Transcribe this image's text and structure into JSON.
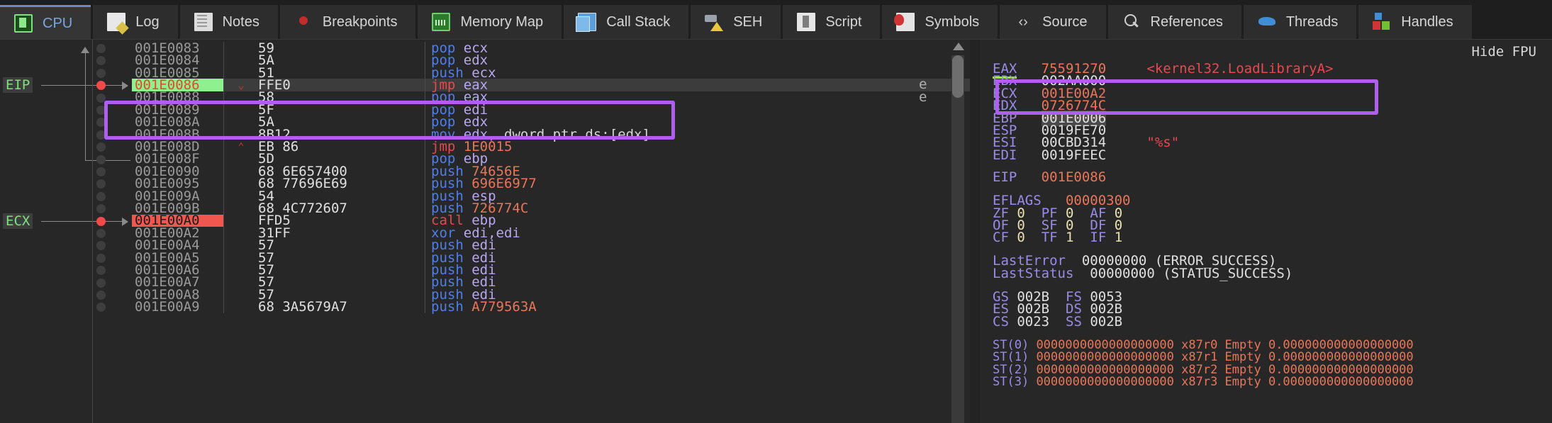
{
  "tabs": [
    {
      "label": "CPU",
      "icon": "cpu-icon",
      "active": true
    },
    {
      "label": "Log",
      "icon": "log-icon",
      "active": false
    },
    {
      "label": "Notes",
      "icon": "notes-icon",
      "active": false
    },
    {
      "label": "Breakpoints",
      "icon": "breakpoint-icon",
      "active": false
    },
    {
      "label": "Memory Map",
      "icon": "memory-map-icon",
      "active": false
    },
    {
      "label": "Call Stack",
      "icon": "call-stack-icon",
      "active": false
    },
    {
      "label": "SEH",
      "icon": "seh-icon",
      "active": false
    },
    {
      "label": "Script",
      "icon": "script-icon",
      "active": false
    },
    {
      "label": "Symbols",
      "icon": "symbols-icon",
      "active": false
    },
    {
      "label": "Source",
      "icon": "source-icon",
      "active": false
    },
    {
      "label": "References",
      "icon": "references-icon",
      "active": false
    },
    {
      "label": "Threads",
      "icon": "threads-icon",
      "active": false
    },
    {
      "label": "Handles",
      "icon": "handles-icon",
      "active": false
    }
  ],
  "side_markers": [
    {
      "label": "EIP",
      "row": 3
    },
    {
      "label": "ECX",
      "row": 14
    }
  ],
  "disassembly": {
    "rows": [
      {
        "addr": "001E0083",
        "bytes": "59",
        "mn": "pop",
        "ops": [
          {
            "t": "reg",
            "v": "ecx"
          }
        ],
        "bp": false,
        "state": "normal",
        "arrow": ""
      },
      {
        "addr": "001E0084",
        "bytes": "5A",
        "mn": "pop",
        "ops": [
          {
            "t": "reg",
            "v": "edx"
          }
        ],
        "bp": false,
        "state": "normal",
        "arrow": ""
      },
      {
        "addr": "001E0085",
        "bytes": "51",
        "mn": "push",
        "ops": [
          {
            "t": "reg",
            "v": "ecx"
          }
        ],
        "bp": false,
        "state": "normal",
        "arrow": ""
      },
      {
        "addr": "001E0086",
        "bytes": "FFE0",
        "mn": "jmp",
        "ops": [
          {
            "t": "reg",
            "v": "eax"
          }
        ],
        "bp": true,
        "state": "eip",
        "arrow": "v"
      },
      {
        "addr": "001E0088",
        "bytes": "58",
        "mn": "pop",
        "ops": [
          {
            "t": "reg",
            "v": "eax"
          }
        ],
        "bp": false,
        "state": "normal",
        "arrow": ""
      },
      {
        "addr": "001E0089",
        "bytes": "5F",
        "mn": "pop",
        "ops": [
          {
            "t": "reg",
            "v": "edi"
          }
        ],
        "bp": false,
        "state": "normal",
        "arrow": ""
      },
      {
        "addr": "001E008A",
        "bytes": "5A",
        "mn": "pop",
        "ops": [
          {
            "t": "reg",
            "v": "edx"
          }
        ],
        "bp": false,
        "state": "normal",
        "arrow": ""
      },
      {
        "addr": "001E008B",
        "bytes": "8B12",
        "mn": "mov",
        "ops": [
          {
            "t": "reg",
            "v": "edx,"
          },
          {
            "t": "mem",
            "v": "dword ptr  ds:[edx]"
          }
        ],
        "bp": false,
        "state": "normal",
        "arrow": ""
      },
      {
        "addr": "001E008D",
        "bytes": "EB 86",
        "mn": "jmp",
        "ops": [
          {
            "t": "imm",
            "v": "1E0015"
          }
        ],
        "bp": false,
        "state": "normal",
        "arrow": "^"
      },
      {
        "addr": "001E008F",
        "bytes": "5D",
        "mn": "pop",
        "ops": [
          {
            "t": "reg",
            "v": "ebp"
          }
        ],
        "bp": false,
        "state": "normal",
        "arrow": ""
      },
      {
        "addr": "001E0090",
        "bytes": "68 6E657400",
        "mn": "push",
        "ops": [
          {
            "t": "imm",
            "v": "74656E"
          }
        ],
        "bp": false,
        "state": "normal",
        "arrow": ""
      },
      {
        "addr": "001E0095",
        "bytes": "68 77696E69",
        "mn": "push",
        "ops": [
          {
            "t": "imm",
            "v": "696E6977"
          }
        ],
        "bp": false,
        "state": "normal",
        "arrow": ""
      },
      {
        "addr": "001E009A",
        "bytes": "54",
        "mn": "push",
        "ops": [
          {
            "t": "reg",
            "v": "esp"
          }
        ],
        "bp": false,
        "state": "normal",
        "arrow": ""
      },
      {
        "addr": "001E009B",
        "bytes": "68 4C772607",
        "mn": "push",
        "ops": [
          {
            "t": "imm",
            "v": "726774C"
          }
        ],
        "bp": false,
        "state": "normal",
        "arrow": ""
      },
      {
        "addr": "001E00A0",
        "bytes": "FFD5",
        "mn": "call",
        "ops": [
          {
            "t": "reg",
            "v": "ebp"
          }
        ],
        "bp": true,
        "state": "bp",
        "arrow": ""
      },
      {
        "addr": "001E00A2",
        "bytes": "31FF",
        "mn": "xor",
        "ops": [
          {
            "t": "reg",
            "v": "edi,edi"
          }
        ],
        "bp": false,
        "state": "normal",
        "arrow": ""
      },
      {
        "addr": "001E00A4",
        "bytes": "57",
        "mn": "push",
        "ops": [
          {
            "t": "reg",
            "v": "edi"
          }
        ],
        "bp": false,
        "state": "normal",
        "arrow": ""
      },
      {
        "addr": "001E00A5",
        "bytes": "57",
        "mn": "push",
        "ops": [
          {
            "t": "reg",
            "v": "edi"
          }
        ],
        "bp": false,
        "state": "normal",
        "arrow": ""
      },
      {
        "addr": "001E00A6",
        "bytes": "57",
        "mn": "push",
        "ops": [
          {
            "t": "reg",
            "v": "edi"
          }
        ],
        "bp": false,
        "state": "normal",
        "arrow": ""
      },
      {
        "addr": "001E00A7",
        "bytes": "57",
        "mn": "push",
        "ops": [
          {
            "t": "reg",
            "v": "edi"
          }
        ],
        "bp": false,
        "state": "normal",
        "arrow": ""
      },
      {
        "addr": "001E00A8",
        "bytes": "57",
        "mn": "push",
        "ops": [
          {
            "t": "reg",
            "v": "edi"
          }
        ],
        "bp": false,
        "state": "normal",
        "arrow": ""
      },
      {
        "addr": "001E00A9",
        "bytes": "68 3A5679A7",
        "mn": "push",
        "ops": [
          {
            "t": "imm",
            "v": "A779563A"
          }
        ],
        "bp": false,
        "state": "normal",
        "arrow": ""
      }
    ],
    "comments": [
      "e",
      "e"
    ]
  },
  "registers": {
    "hide_fpu_label": "Hide FPU",
    "general": [
      {
        "name": "EAX",
        "value": "75591270",
        "red": true,
        "modified": true,
        "hl": false,
        "comment": "<kernel32.LoadLibraryA>",
        "comment_kind": "symbol"
      },
      {
        "name": "EBX",
        "value": "002AA000",
        "red": false,
        "modified": false,
        "hl": false,
        "comment": "",
        "comment_kind": ""
      },
      {
        "name": "ECX",
        "value": "001E00A2",
        "red": true,
        "modified": false,
        "hl": false,
        "comment": "",
        "comment_kind": ""
      },
      {
        "name": "EDX",
        "value": "0726774C",
        "red": true,
        "modified": false,
        "hl": false,
        "comment": "",
        "comment_kind": ""
      },
      {
        "name": "EBP",
        "value": "001E0006",
        "red": false,
        "modified": false,
        "hl": true,
        "comment": "",
        "comment_kind": ""
      },
      {
        "name": "ESP",
        "value": "0019FE70",
        "red": false,
        "modified": false,
        "hl": false,
        "comment": "",
        "comment_kind": ""
      },
      {
        "name": "ESI",
        "value": "00CBD314",
        "red": false,
        "modified": false,
        "hl": false,
        "comment": "\"%s\"",
        "comment_kind": "string"
      },
      {
        "name": "EDI",
        "value": "0019FEEC",
        "red": false,
        "modified": false,
        "hl": false,
        "comment": "",
        "comment_kind": ""
      }
    ],
    "eip": {
      "name": "EIP",
      "value": "001E0086"
    },
    "eflags": {
      "name": "EFLAGS",
      "value": "00000300"
    },
    "flags": [
      [
        {
          "n": "ZF",
          "v": "0"
        },
        {
          "n": "PF",
          "v": "0"
        },
        {
          "n": "AF",
          "v": "0"
        }
      ],
      [
        {
          "n": "OF",
          "v": "0"
        },
        {
          "n": "SF",
          "v": "0"
        },
        {
          "n": "DF",
          "v": "0"
        }
      ],
      [
        {
          "n": "CF",
          "v": "0"
        },
        {
          "n": "TF",
          "v": "1"
        },
        {
          "n": "IF",
          "v": "1"
        }
      ]
    ],
    "last": [
      {
        "name": "LastError",
        "value": "00000000 (ERROR_SUCCESS)"
      },
      {
        "name": "LastStatus",
        "value": "00000000 (STATUS_SUCCESS)"
      }
    ],
    "segments": [
      [
        {
          "n": "GS",
          "v": "002B"
        },
        {
          "n": "FS",
          "v": "0053"
        }
      ],
      [
        {
          "n": "ES",
          "v": "002B"
        },
        {
          "n": "DS",
          "v": "002B"
        }
      ],
      [
        {
          "n": "CS",
          "v": "0023"
        },
        {
          "n": "SS",
          "v": "002B"
        }
      ]
    ],
    "fpu": [
      {
        "name": "ST(0)",
        "value": "0000000000000000000 x87r0 Empty 0.000000000000000000"
      },
      {
        "name": "ST(1)",
        "value": "0000000000000000000 x87r1 Empty 0.000000000000000000"
      },
      {
        "name": "ST(2)",
        "value": "0000000000000000000 x87r2 Empty 0.000000000000000000"
      },
      {
        "name": "ST(3)",
        "value": "0000000000000000000 x87r3 Empty 0.000000000000000000"
      }
    ]
  },
  "colors": {
    "accent_highlight": "#b05ef0",
    "eip_row": "#8ef08e",
    "breakpoint_row": "#f0574f",
    "mnemonic": "#4f7fe8",
    "jump": "#e8484f",
    "register_op": "#b9a8f0",
    "immediate": "#e8765a",
    "background": "#272727"
  }
}
